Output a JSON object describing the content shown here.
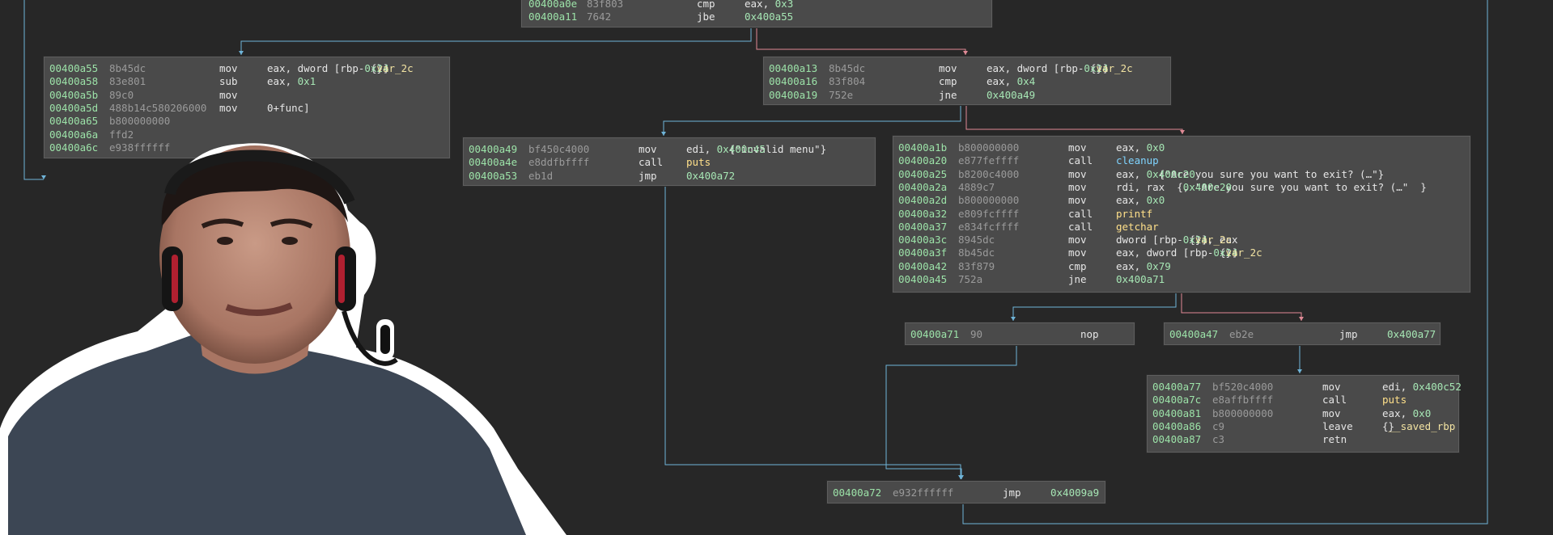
{
  "colors": {
    "background": "#272727",
    "block_fill": "#4a4a4a",
    "address": "#9ce2a8",
    "bytes": "#9a9a9a",
    "edge_true": "#6fb4d8",
    "edge_false": "#e08a96",
    "function_name": "#ffe08a",
    "cleanup_name": "#7fd4ff",
    "variable": "#f2e3a2"
  },
  "blocks": [
    {
      "id": "top",
      "rows": [
        {
          "addr": "00400a0e",
          "bytes": "83f803",
          "mn": "cmp",
          "op": "eax, 0x3"
        },
        {
          "addr": "00400a11",
          "bytes": "7642",
          "mn": "jbe",
          "op": "0x400a55"
        }
      ]
    },
    {
      "id": "a55",
      "rows": [
        {
          "addr": "00400a55",
          "bytes": "8b45dc",
          "mn": "mov",
          "op": "eax, dword [rbp-0x24 {var_2c}]"
        },
        {
          "addr": "00400a58",
          "bytes": "83e801",
          "mn": "sub",
          "op": "eax, 0x1"
        },
        {
          "addr": "00400a5b",
          "bytes": "89c0",
          "mn": "mov",
          "op": ""
        },
        {
          "addr": "00400a5d",
          "bytes": "488b14c580206000",
          "mn": "mov",
          "op": "0+func]"
        },
        {
          "addr": "00400a65",
          "bytes": "b800000000",
          "mn": "",
          "op": ""
        },
        {
          "addr": "00400a6a",
          "bytes": "ffd2",
          "mn": "",
          "op": ""
        },
        {
          "addr": "00400a6c",
          "bytes": "e938ffffff",
          "mn": "",
          "op": ""
        }
      ]
    },
    {
      "id": "a13",
      "rows": [
        {
          "addr": "00400a13",
          "bytes": "8b45dc",
          "mn": "mov",
          "op": "eax, dword [rbp-0x24 {var_2c}]"
        },
        {
          "addr": "00400a16",
          "bytes": "83f804",
          "mn": "cmp",
          "op": "eax, 0x4"
        },
        {
          "addr": "00400a19",
          "bytes": "752e",
          "mn": "jne",
          "op": "0x400a49"
        }
      ]
    },
    {
      "id": "a49",
      "rows": [
        {
          "addr": "00400a49",
          "bytes": "bf450c4000",
          "mn": "mov",
          "op": "edi, 0x400c45  {\"invalid menu\"}"
        },
        {
          "addr": "00400a4e",
          "bytes": "e8ddfbffff",
          "mn": "call",
          "op": "puts"
        },
        {
          "addr": "00400a53",
          "bytes": "eb1d",
          "mn": "jmp",
          "op": "0x400a72"
        }
      ]
    },
    {
      "id": "a1b",
      "rows": [
        {
          "addr": "00400a1b",
          "bytes": "b800000000",
          "mn": "mov",
          "op": "eax, 0x0"
        },
        {
          "addr": "00400a20",
          "bytes": "e877feffff",
          "mn": "call",
          "op": "cleanup"
        },
        {
          "addr": "00400a25",
          "bytes": "b8200c4000",
          "mn": "mov",
          "op": "eax, 0x400c20  {\"Are you sure you want to exit? (…\"}"
        },
        {
          "addr": "00400a2a",
          "bytes": "4889c7",
          "mn": "mov",
          "op": "rdi, rax  {0x400c20, \"Are you sure you want to exit? (…\"  }"
        },
        {
          "addr": "00400a2d",
          "bytes": "b800000000",
          "mn": "mov",
          "op": "eax, 0x0"
        },
        {
          "addr": "00400a32",
          "bytes": "e809fcffff",
          "mn": "call",
          "op": "printf"
        },
        {
          "addr": "00400a37",
          "bytes": "e834fcffff",
          "mn": "call",
          "op": "getchar"
        },
        {
          "addr": "00400a3c",
          "bytes": "8945dc",
          "mn": "mov",
          "op": "dword [rbp-0x24 {var_2c}], eax"
        },
        {
          "addr": "00400a3f",
          "bytes": "8b45dc",
          "mn": "mov",
          "op": "eax, dword [rbp-0x24 {var_2c}]"
        },
        {
          "addr": "00400a42",
          "bytes": "83f879",
          "mn": "cmp",
          "op": "eax, 0x79"
        },
        {
          "addr": "00400a45",
          "bytes": "752a",
          "mn": "jne",
          "op": "0x400a71"
        }
      ]
    },
    {
      "id": "a71",
      "rows": [
        {
          "addr": "00400a71",
          "bytes": "90",
          "mn": "nop",
          "op": ""
        }
      ]
    },
    {
      "id": "a47",
      "rows": [
        {
          "addr": "00400a47",
          "bytes": "eb2e",
          "mn": "jmp",
          "op": "0x400a77"
        }
      ]
    },
    {
      "id": "a77",
      "rows": [
        {
          "addr": "00400a77",
          "bytes": "bf520c4000",
          "mn": "mov",
          "op": "edi, 0x400c52"
        },
        {
          "addr": "00400a7c",
          "bytes": "e8affbffff",
          "mn": "call",
          "op": "puts"
        },
        {
          "addr": "00400a81",
          "bytes": "b800000000",
          "mn": "mov",
          "op": "eax, 0x0"
        },
        {
          "addr": "00400a86",
          "bytes": "c9",
          "mn": "leave",
          "op": "{__saved_rbp}"
        },
        {
          "addr": "00400a87",
          "bytes": "c3",
          "mn": "retn",
          "op": ""
        }
      ]
    },
    {
      "id": "a72",
      "rows": [
        {
          "addr": "00400a72",
          "bytes": "e932ffffff",
          "mn": "jmp",
          "op": "0x4009a9"
        }
      ]
    }
  ]
}
